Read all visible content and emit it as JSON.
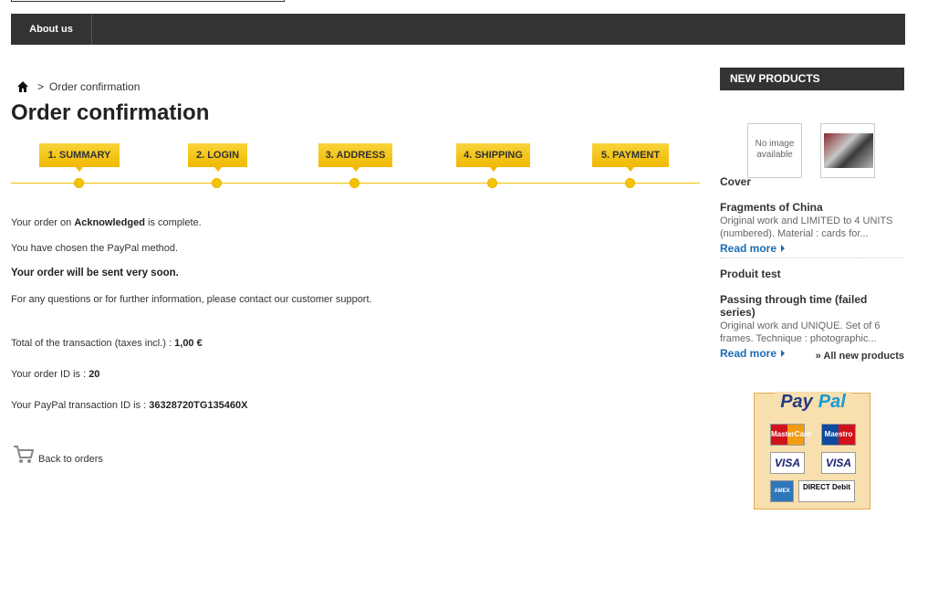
{
  "nav": {
    "about_label": "About us"
  },
  "breadcrumb": {
    "separator": ">",
    "current": "Order confirmation"
  },
  "page_title": "Order confirmation",
  "steps": [
    {
      "label": "1. SUMMARY"
    },
    {
      "label": "2. LOGIN"
    },
    {
      "label": "3. ADDRESS"
    },
    {
      "label": "4. SHIPPING"
    },
    {
      "label": "5. PAYMENT"
    }
  ],
  "content": {
    "line1_pre": "Your order on ",
    "line1_shop": "Acknowledged",
    "line1_post": " is complete.",
    "line2": "You have chosen the PayPal method.",
    "line3": "Your order will be sent very soon.",
    "line4": "For any questions or for further information, please contact our customer support.",
    "total_label": "Total of the transaction (taxes incl.) : ",
    "total_value": "1,00 €",
    "order_id_label": "Your order ID is : ",
    "order_id_value": "20",
    "paypal_tx_label": "Your PayPal transaction ID is : ",
    "paypal_tx_value": "36328720TG135460X"
  },
  "back_orders": "Back to orders",
  "sidebar": {
    "header": "NEW PRODUCTS",
    "no_image_text": "No image available",
    "products": [
      {
        "category": "Cover",
        "name": "Fragments of China",
        "desc": "Original work and LIMITED to 4 UNITS (numbered). Material : cards for...",
        "read_more": "Read more"
      },
      {
        "category": "Produit test",
        "name": "Passing through time (failed series)",
        "desc": "Original work and UNIQUE. Set of 6 frames. Technique : photographic...",
        "read_more": "Read more"
      }
    ],
    "all_new": "» All new products"
  },
  "paypal": {
    "pay": "Pay",
    "pal": "Pal",
    "cards": [
      "MasterCard",
      "Maestro",
      "VISA",
      "VISA",
      "AMEX",
      "DIRECT Debit"
    ]
  },
  "colors": {
    "nav_bg": "#333333",
    "step_yellow": "#f5c400",
    "link_blue": "#1a6db3"
  }
}
